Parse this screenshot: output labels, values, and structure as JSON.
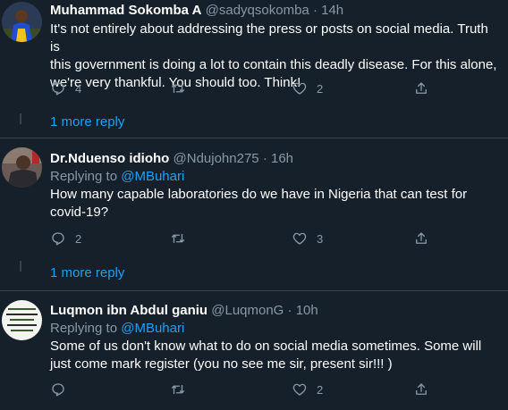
{
  "tweets": [
    {
      "name": "Muhammad Sokomba A",
      "handle": "@sadyqsokomba",
      "dot": "·",
      "time": "14h",
      "replying_label": "",
      "replying_mention": "",
      "text_lines": [
        "It's not entirely about addressing the press or posts on social media. Truth is",
        "this government is doing a lot to contain this deadly disease. For this alone,",
        "we're very thankful. You should too. Think!"
      ],
      "reply_count": "4",
      "retweet_count": "",
      "like_count": "2",
      "more_replies": "1 more reply"
    },
    {
      "name": "Dr.Nduenso idioho",
      "handle": "@Ndujohn275",
      "dot": "·",
      "time": "16h",
      "replying_label": "Replying to",
      "replying_mention": "@MBuhari",
      "text_lines": [
        "How many capable laboratories do we have in Nigeria that can test for",
        "covid-19?"
      ],
      "reply_count": "2",
      "retweet_count": "",
      "like_count": "3",
      "more_replies": "1 more reply"
    },
    {
      "name": "Luqmon ibn Abdul ganiu",
      "handle": "@LuqmonG",
      "dot": "·",
      "time": "10h",
      "replying_label": "Replying to",
      "replying_mention": "@MBuhari",
      "text_lines": [
        "Some of us don't know what to do on social media sometimes. Some will",
        "just come mark register (you no see me sir,  present sir!!!  )"
      ],
      "reply_count": "",
      "retweet_count": "",
      "like_count": "2",
      "more_replies": ""
    }
  ],
  "icons": {
    "reply": "reply-icon",
    "retweet": "retweet-icon",
    "like": "like-icon",
    "share": "share-icon"
  },
  "colors": {
    "background": "#15202b",
    "divider": "#38444d",
    "muted": "#8899a6",
    "accent": "#1da1f2",
    "text": "#ffffff"
  }
}
